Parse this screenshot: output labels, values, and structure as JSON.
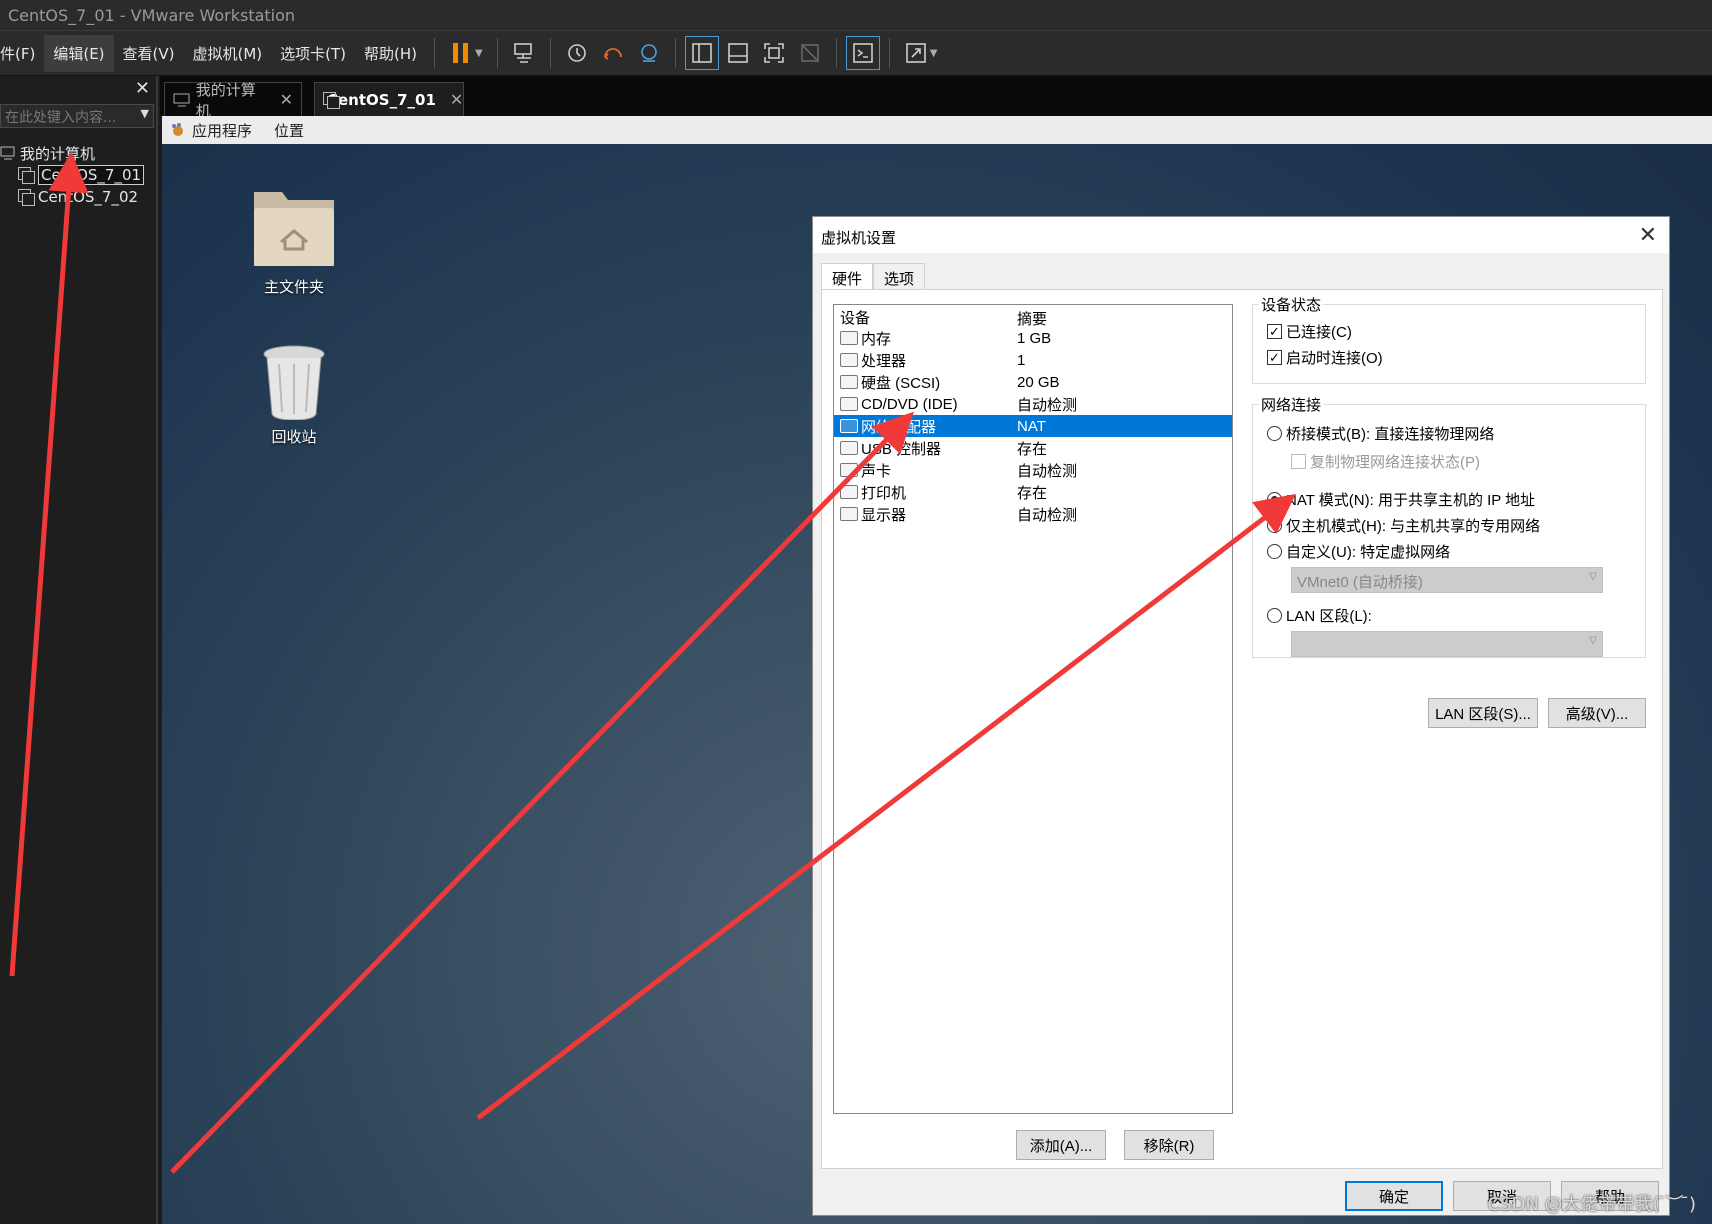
{
  "window": {
    "title": "CentOS_7_01 - VMware Workstation"
  },
  "menu": [
    "件(F)",
    "编辑(E)",
    "查看(V)",
    "虚拟机(M)",
    "选项卡(T)",
    "帮助(H)"
  ],
  "toolbar_icons": [
    "pause-icon",
    "send-keys-icon",
    "snapshot-icon",
    "revert-snapshot-icon",
    "snapshot-manager-icon",
    "show-library-icon",
    "thumbnail-bar-icon",
    "fullscreen-icon",
    "unity-icon",
    "console-icon",
    "stretch-icon"
  ],
  "library": {
    "close": "✕",
    "search_placeholder": "在此处键入内容...",
    "root": "我的计算机",
    "vms": [
      "CentOS_7_01",
      "CentOS_7_02"
    ],
    "selected_vm": "CentOS_7_01"
  },
  "tabs": [
    {
      "label": "我的计算机",
      "active": false
    },
    {
      "label": "CentOS_7_01",
      "active": true
    }
  ],
  "guest": {
    "topbar": [
      "应用程序",
      "位置"
    ],
    "desktop_icons": [
      "主文件夹",
      "回收站"
    ]
  },
  "dialog": {
    "title": "虚拟机设置",
    "tabs": [
      "硬件",
      "选项"
    ],
    "device_header": [
      "设备",
      "摘要"
    ],
    "devices": [
      {
        "name": "内存",
        "summary": "1 GB"
      },
      {
        "name": "处理器",
        "summary": "1"
      },
      {
        "name": "硬盘 (SCSI)",
        "summary": "20 GB"
      },
      {
        "name": "CD/DVD (IDE)",
        "summary": "自动检测"
      },
      {
        "name": "网络适配器",
        "summary": "NAT"
      },
      {
        "name": "USB 控制器",
        "summary": "存在"
      },
      {
        "name": "声卡",
        "summary": "自动检测"
      },
      {
        "name": "打印机",
        "summary": "存在"
      },
      {
        "name": "显示器",
        "summary": "自动检测"
      }
    ],
    "selected_device": "网络适配器",
    "buttons": {
      "add": "添加(A)...",
      "remove": "移除(R)",
      "lan_segments": "LAN 区段(S)...",
      "advanced": "高级(V)...",
      "ok": "确定",
      "cancel": "取消",
      "help": "帮助"
    },
    "device_status": {
      "title": "设备状态",
      "connected": "已连接(C)",
      "connect_at_power_on": "启动时连接(O)"
    },
    "network": {
      "title": "网络连接",
      "bridged": "桥接模式(B): 直接连接物理网络",
      "replicate": "复制物理网络连接状态(P)",
      "nat": "NAT 模式(N): 用于共享主机的 IP 地址",
      "host_only": "仅主机模式(H): 与主机共享的专用网络",
      "custom": "自定义(U): 特定虚拟网络",
      "custom_value": "VMnet0 (自动桥接)",
      "lan_segment": "LAN 区段(L):",
      "selected": "nat"
    }
  },
  "watermark": "CSDN @大佬带带我( ̄︶ ̄)",
  "annotation_color": "#f03a3a"
}
